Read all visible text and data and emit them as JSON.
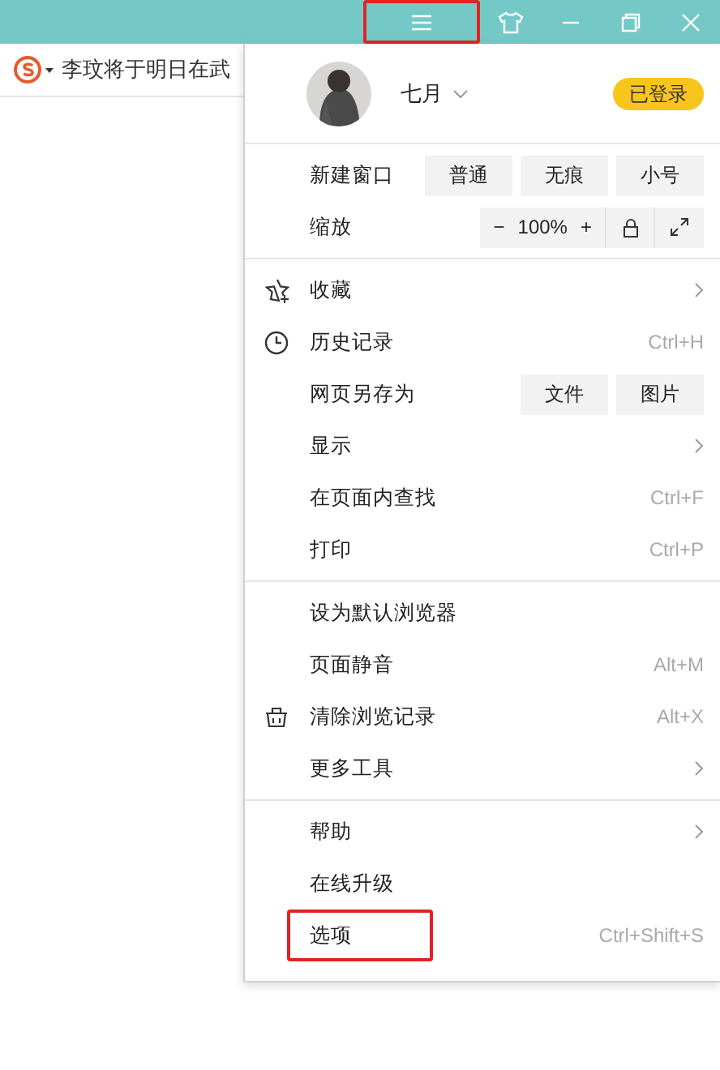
{
  "title_bar": {
    "buttons": [
      {
        "kind": "menu",
        "highlighted": true
      },
      {
        "kind": "skin",
        "highlighted": false
      },
      {
        "kind": "minimize",
        "highlighted": false
      },
      {
        "kind": "restore",
        "highlighted": false
      },
      {
        "kind": "close",
        "highlighted": false
      }
    ]
  },
  "toolbar": {
    "headline": "李玟将于明日在武"
  },
  "menu": {
    "profile": {
      "name": "七月",
      "login_button": "已登录"
    },
    "sections": [
      [
        {
          "kind": "buttons",
          "label": "新建窗口",
          "buttons": [
            "普通",
            "无痕",
            "小号"
          ]
        },
        {
          "kind": "zoom",
          "label": "缩放",
          "minus": "−",
          "value": "100%",
          "plus": "+"
        }
      ],
      [
        {
          "kind": "item",
          "label": "收藏",
          "submenu": true,
          "highlighted": false
        },
        {
          "kind": "item",
          "label": "历史记录",
          "shortcut": "Ctrl+H",
          "submenu": false,
          "highlighted": false
        },
        {
          "kind": "buttons",
          "label": "网页另存为",
          "buttons": [
            "文件",
            "图片"
          ]
        },
        {
          "kind": "item",
          "label": "显示",
          "submenu": true,
          "highlighted": false
        },
        {
          "kind": "item",
          "label": "在页面内查找",
          "shortcut": "Ctrl+F",
          "submenu": false,
          "highlighted": false
        },
        {
          "kind": "item",
          "label": "打印",
          "shortcut": "Ctrl+P",
          "submenu": false,
          "highlighted": false
        }
      ],
      [
        {
          "kind": "item",
          "label": "设为默认浏览器",
          "submenu": false,
          "highlighted": false
        },
        {
          "kind": "item",
          "label": "页面静音",
          "shortcut": "Alt+M",
          "submenu": false,
          "highlighted": false
        },
        {
          "kind": "item",
          "label": "清除浏览记录",
          "shortcut": "Alt+X",
          "submenu": false,
          "highlighted": false
        },
        {
          "kind": "item",
          "label": "更多工具",
          "submenu": true,
          "highlighted": false
        }
      ],
      [
        {
          "kind": "item",
          "label": "帮助",
          "submenu": true,
          "highlighted": false
        },
        {
          "kind": "item",
          "label": "在线升级",
          "submenu": false,
          "highlighted": false
        },
        {
          "kind": "item",
          "label": "选项",
          "shortcut": "Ctrl+Shift+S",
          "submenu": false,
          "highlighted": true
        }
      ]
    ]
  }
}
